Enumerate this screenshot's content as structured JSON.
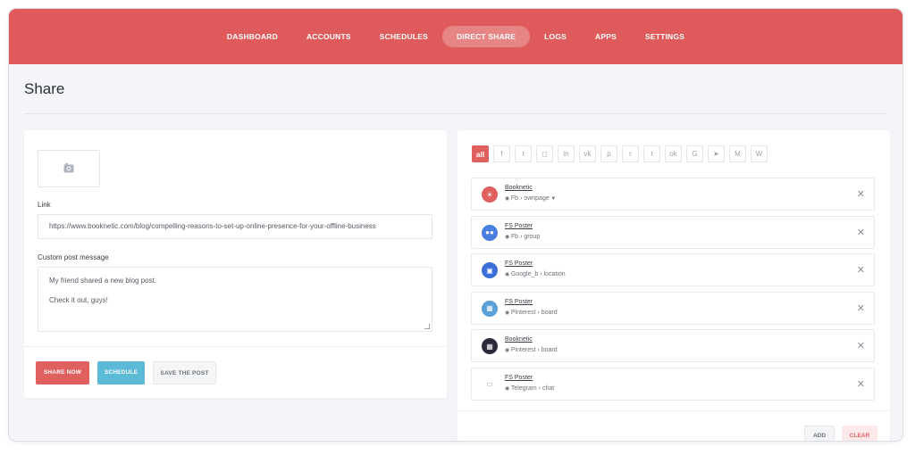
{
  "nav": {
    "items": [
      {
        "label": "DASHBOARD",
        "active": false
      },
      {
        "label": "ACCOUNTS",
        "active": false
      },
      {
        "label": "SCHEDULES",
        "active": false
      },
      {
        "label": "DIRECT SHARE",
        "active": true
      },
      {
        "label": "LOGS",
        "active": false
      },
      {
        "label": "APPS",
        "active": false
      },
      {
        "label": "SETTINGS",
        "active": false
      }
    ],
    "accent": "#df5b5b"
  },
  "page": {
    "title": "Share"
  },
  "form": {
    "image_icon": "image-placeholder-icon",
    "link_label": "Link",
    "link_value": "https://www.booknetic.com/blog/compelling-reasons-to-set-up-online-presence-for-your-offline-business",
    "message_label": "Custom post message",
    "message_lines": [
      "My friend shared a new blog post.",
      "",
      "Check it out, guys!"
    ],
    "buttons": {
      "share_now": "SHARE NOW",
      "schedule": "SCHEDULE",
      "save": "SAVE THE POST"
    }
  },
  "filters": [
    {
      "label": "all",
      "icon": "all",
      "active": true
    },
    {
      "label": "",
      "icon": "facebook-icon"
    },
    {
      "label": "",
      "icon": "twitter-icon"
    },
    {
      "label": "",
      "icon": "instagram-icon"
    },
    {
      "label": "",
      "icon": "linkedin-icon"
    },
    {
      "label": "",
      "icon": "vk-icon"
    },
    {
      "label": "",
      "icon": "pinterest-icon"
    },
    {
      "label": "",
      "icon": "reddit-icon"
    },
    {
      "label": "",
      "icon": "tumblr-icon"
    },
    {
      "label": "",
      "icon": "odnoklassniki-icon"
    },
    {
      "label": "",
      "icon": "google-icon"
    },
    {
      "label": "",
      "icon": "telegram-icon"
    },
    {
      "label": "",
      "icon": "medium-icon"
    },
    {
      "label": "",
      "icon": "wordpress-icon"
    }
  ],
  "accounts": [
    {
      "name": "Booknetic",
      "network": "Fb",
      "type": "ownpage",
      "has_filter": true,
      "avatar_color": "#e05f5f",
      "avatar": "bulb-icon"
    },
    {
      "name": "FS Poster",
      "network": "Fb",
      "type": "group",
      "has_filter": false,
      "avatar_color": "#4a7fe0",
      "avatar": "group-icon"
    },
    {
      "name": "FS Poster",
      "network": "Google_b",
      "type": "location",
      "has_filter": false,
      "avatar_color": "#3d6fd8",
      "avatar": "store-icon"
    },
    {
      "name": "FS Poster",
      "network": "Pinterest",
      "type": "board",
      "has_filter": false,
      "avatar_color": "#5aa0d8",
      "avatar": "board-icon"
    },
    {
      "name": "Booknetic",
      "network": "Pinterest",
      "type": "board",
      "has_filter": false,
      "avatar_color": "#2a2a3a",
      "avatar": "board-icon"
    },
    {
      "name": "FS Poster",
      "network": "Telegram",
      "type": "chat",
      "has_filter": false,
      "avatar_color": "#ffffff",
      "avatar": "image-icon"
    }
  ],
  "actions": {
    "add": "ADD",
    "clear": "CLEAR"
  }
}
